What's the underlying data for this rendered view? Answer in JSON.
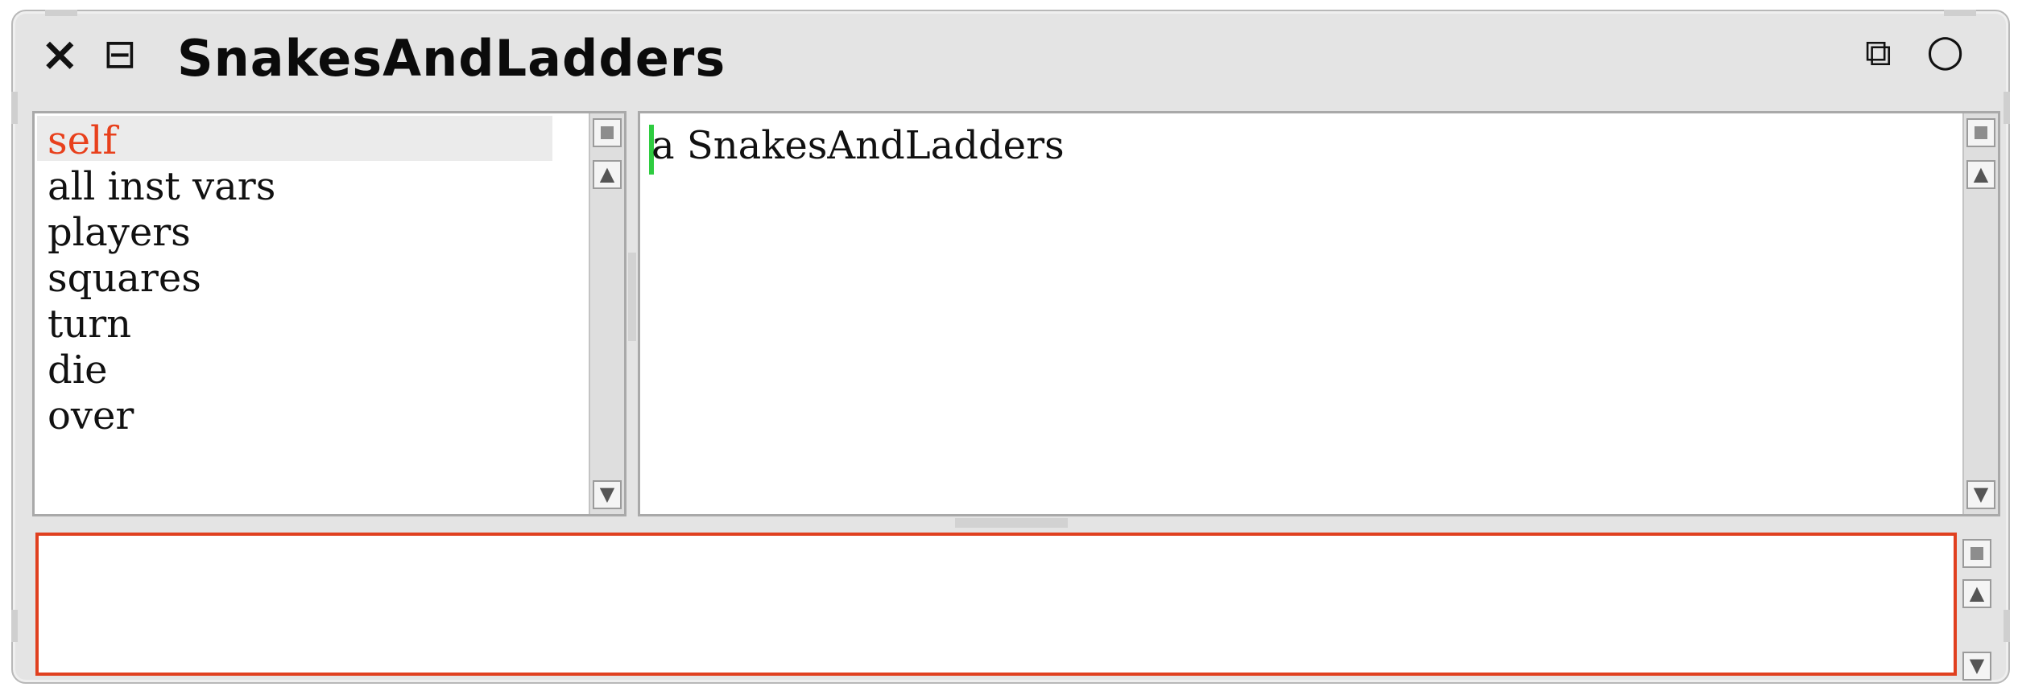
{
  "window": {
    "title": "SnakesAndLadders",
    "close_icon": "×",
    "menu_icon": "⊟",
    "collapse_icon": "⧉",
    "expand_icon": "○"
  },
  "inspector": {
    "fields": [
      {
        "label": "self",
        "selected": true
      },
      {
        "label": "all inst vars",
        "selected": false
      },
      {
        "label": "players",
        "selected": false
      },
      {
        "label": "squares",
        "selected": false
      },
      {
        "label": "turn",
        "selected": false
      },
      {
        "label": "die",
        "selected": false
      },
      {
        "label": "over",
        "selected": false
      }
    ],
    "value_text": "a SnakesAndLadders",
    "evaluator_text": ""
  },
  "colors": {
    "selected_text": "#e8401c",
    "evaluator_border": "#e0401f",
    "cursor": "#2ecc40"
  }
}
